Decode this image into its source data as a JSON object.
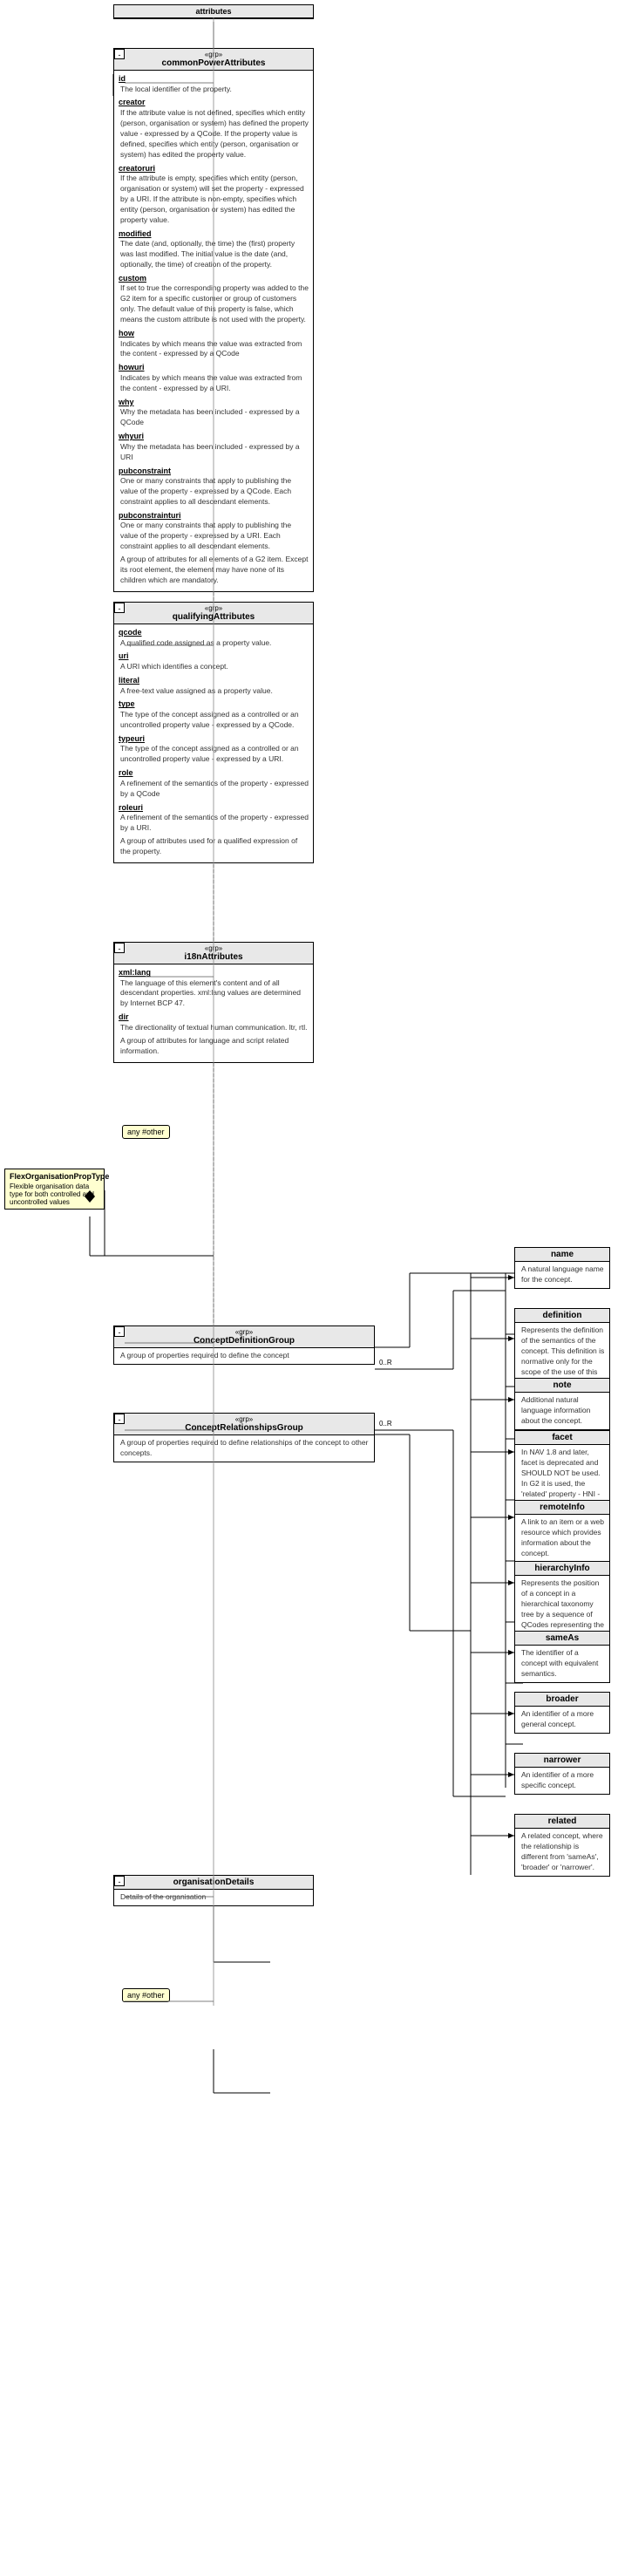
{
  "title": "attributes",
  "commonPowerAttributes": {
    "stereotype": "grp",
    "name": "commonPowerAttributes",
    "fields": [
      {
        "name": "id",
        "dotted": true,
        "desc": "The local identifier of the property."
      },
      {
        "name": "creator",
        "dotted": true,
        "desc": "If the attribute value is not defined, specifies which entity (person, organisation or system) has defined the property value - expressed by a QCode. If the property value is defined, specifies which entity (person, organisation or system) has edited the property value."
      },
      {
        "name": "creatoruri",
        "dotted": true,
        "desc": "If the attribute is empty, specifies which entity (person, organisation or system) will set the property - expressed by a URI. If the attribute is non-empty, specifies which entity (person, organisation or system) has edited the property value."
      },
      {
        "name": "modified",
        "dotted": true,
        "desc": "The date (and, optionally, the time) the (first) property was last modified. The initial value is the date (and, optionally, the time) of creation of the property."
      },
      {
        "name": "custom",
        "dotted": true,
        "desc": "If set to true the corresponding property was added to the G2 item for a specific customer or group of customers only. The default value of this property is false, which means the custom attribute is not used with the property."
      },
      {
        "name": "how",
        "dotted": true,
        "desc": "Indicates by which means the value was extracted from the content - expressed by a QCode"
      },
      {
        "name": "howuri",
        "dotted": true,
        "desc": "Indicates by which means the value was extracted from the content - expressed by a URI."
      },
      {
        "name": "why",
        "dotted": true,
        "desc": "Why the metadata has been included - expressed by a QCode"
      },
      {
        "name": "whyuri",
        "dotted": true,
        "desc": "Why the metadata has been included - expressed by a URI"
      },
      {
        "name": "pubconstraint",
        "dotted": true,
        "desc": "One or many constraints that apply to publishing the value of the property - expressed by a QCode. Each constraint applies to all descendant elements."
      },
      {
        "name": "pubconstrainturi",
        "dotted": true,
        "desc": "One or many constraints that apply to publishing the value of the property - expressed by a URI. Each constraint applies to all descendant elements."
      },
      {
        "name": "desc_end",
        "dotted": false,
        "desc": "A group of attributes for all elements of a G2 item. Except its root element, the element may have none of its children which are mandatory."
      }
    ]
  },
  "qualifyingAttributes": {
    "stereotype": "grp",
    "name": "qualifyingAttributes",
    "fields": [
      {
        "name": "qcode",
        "dotted": true,
        "desc": "A qualified code assigned as a property value."
      },
      {
        "name": "uri",
        "dotted": true,
        "desc": "A URI which identifies a concept."
      },
      {
        "name": "literal",
        "dotted": true,
        "desc": "A free-text value assigned as a property value."
      },
      {
        "name": "type",
        "dotted": true,
        "desc": "The type of the concept assigned as a controlled or an uncontrolled property value - expressed by a QCode."
      },
      {
        "name": "typeuri",
        "dotted": true,
        "desc": "The type of the concept assigned as a controlled or an uncontrolled property value - expressed by a URI."
      },
      {
        "name": "role",
        "dotted": true,
        "desc": "A refinement of the semantics of the property - expressed by a QCode"
      },
      {
        "name": "roleuri",
        "dotted": true,
        "desc": "A refinement of the semantics of the property - expressed by a URI."
      },
      {
        "name": "desc_end",
        "dotted": false,
        "desc": "A group of attributes used for a qualified expression of the property."
      }
    ]
  },
  "i18nAttributes": {
    "stereotype": "grp",
    "name": "i18nAttributes",
    "fields": [
      {
        "name": "xmllang",
        "dotted": true,
        "desc": "The language of this element's content and of all descendant properties. xml:lang values are determined by Internet BCP 47."
      },
      {
        "name": "dir",
        "dotted": true,
        "desc": "The directionality of textual human communication. ltr, rtl."
      },
      {
        "name": "desc_end",
        "dotted": false,
        "desc": "A group of attributes for language and script related information."
      }
    ]
  },
  "flexOrganisationPropType": {
    "name": "FlexOrganisationPropType",
    "desc": "Flexible organisation data type for both controlled and uncontrolled values"
  },
  "rightPanel": {
    "nameField": {
      "name": "name",
      "desc": "A natural language name for the concept."
    },
    "definitionField": {
      "name": "definition",
      "desc": "Represents the definition of the semantics of the concept. This definition is normative only for the scope of the use of this concept."
    },
    "noteField": {
      "name": "note",
      "desc": "Additional natural language information about the concept."
    },
    "facetField": {
      "name": "facet",
      "desc": "In NAV 1.8 and later, facet is deprecated and SHOULD NOT be used. In G2 it is used, the 'related' property - HNI - SHOULD be preferred. An intrinsic property of the concept."
    },
    "remoteInfoField": {
      "name": "remoteInfo",
      "desc": "A link to an item or a web resource which provides information about the concept."
    },
    "hierarchyInfoField": {
      "name": "hierarchyInfo",
      "desc": "Represents the position of a concept in a hierarchical taxonomy tree by a sequence of QCodes representing the ancestor concepts of this concept."
    },
    "sameAsField": {
      "name": "sameAs",
      "desc": "The identifier of a concept with equivalent semantics."
    },
    "broaderField": {
      "name": "broader",
      "desc": "An identifier of a more general concept."
    },
    "narrowerField": {
      "name": "narrower",
      "desc": "An identifier of a more specific concept."
    },
    "relatedField": {
      "name": "related",
      "desc": "A related concept, where the relationship is different from 'sameAs', 'broader' or 'narrower'."
    }
  },
  "conceptDefinitionGroup": {
    "stereotype": "grp",
    "name": "ConceptDefinitionGroup",
    "desc": "A group of properties required to define the concept"
  },
  "conceptRelationshipsGroup": {
    "stereotype": "grp",
    "name": "ConceptRelationshipsGroup",
    "desc": "A group of properties required to define relationships of the concept to other concepts."
  },
  "organisationDetails": {
    "name": "organisationDetails",
    "desc": "Details of the organisation"
  },
  "anyOther": {
    "label": "any #other"
  },
  "connectors": {
    "multiplicity1": "0..R",
    "multiplicity2": "0..R"
  }
}
